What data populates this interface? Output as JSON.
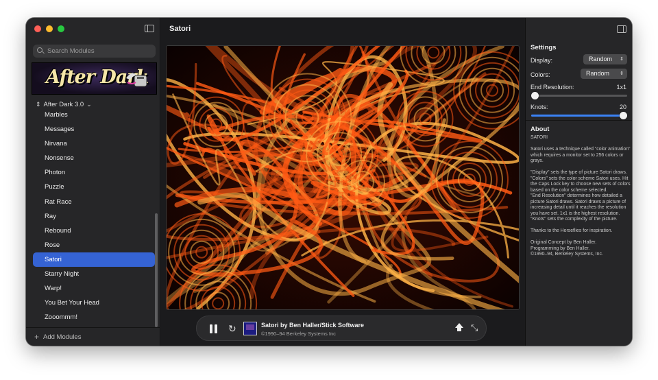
{
  "sidebar": {
    "search_placeholder": "Search Modules",
    "banner_text": "After Dark",
    "group_label": "After Dark 3.0",
    "modules": [
      "Marbles",
      "Messages",
      "Nirvana",
      "Nonsense",
      "Photon",
      "Puzzle",
      "Rat Race",
      "Ray",
      "Rebound",
      "Rose",
      "Satori",
      "Starry Night",
      "Warp!",
      "You Bet Your Head",
      "Zooommm!"
    ],
    "selected_module": "Satori",
    "add_modules_label": "Add Modules"
  },
  "main": {
    "title": "Satori",
    "credit_title": "Satori by Ben Haller/Stick Software",
    "credit_subtitle": "©1990–94 Berkeley Systems Inc"
  },
  "inspector": {
    "settings_title": "Settings",
    "display_label": "Display:",
    "display_value": "Random",
    "colors_label": "Colors:",
    "colors_value": "Random",
    "end_resolution_label": "End Resolution:",
    "end_resolution_value": "1x1",
    "end_resolution_level": 0.0,
    "knots_label": "Knots:",
    "knots_value": "20",
    "knots_level": 1.0,
    "about_title": "About",
    "about_paragraphs": [
      "SATORI",
      "Satori uses a technique called \"color animation\" which requires a monitor set to 256 colors or grays.",
      "\"Display\" sets the type of picture Satori draws.\n\"Colors\" sets the color scheme Satori uses. Hit the Caps Lock key to choose new sets of colors based on the color scheme selected.\n\"End Resolution\" determines how detailed a picture Satori draws.  Satori draws a picture of increasing detail until it reaches the resolution you have set. 1x1 is the highest resolution.\n\"Knots\" sets the complexity of the picture.",
      "Thanks to the Horseflies for inspiration.",
      "Original Concept by Ben Haller.\nProgramming by Ben Haller.\n©1990–94, Berkeley Systems, Inc."
    ]
  },
  "colors": {
    "accent": "#3563d4",
    "preview_primary": "#ff5a14",
    "preview_secondary": "#ffb347"
  }
}
